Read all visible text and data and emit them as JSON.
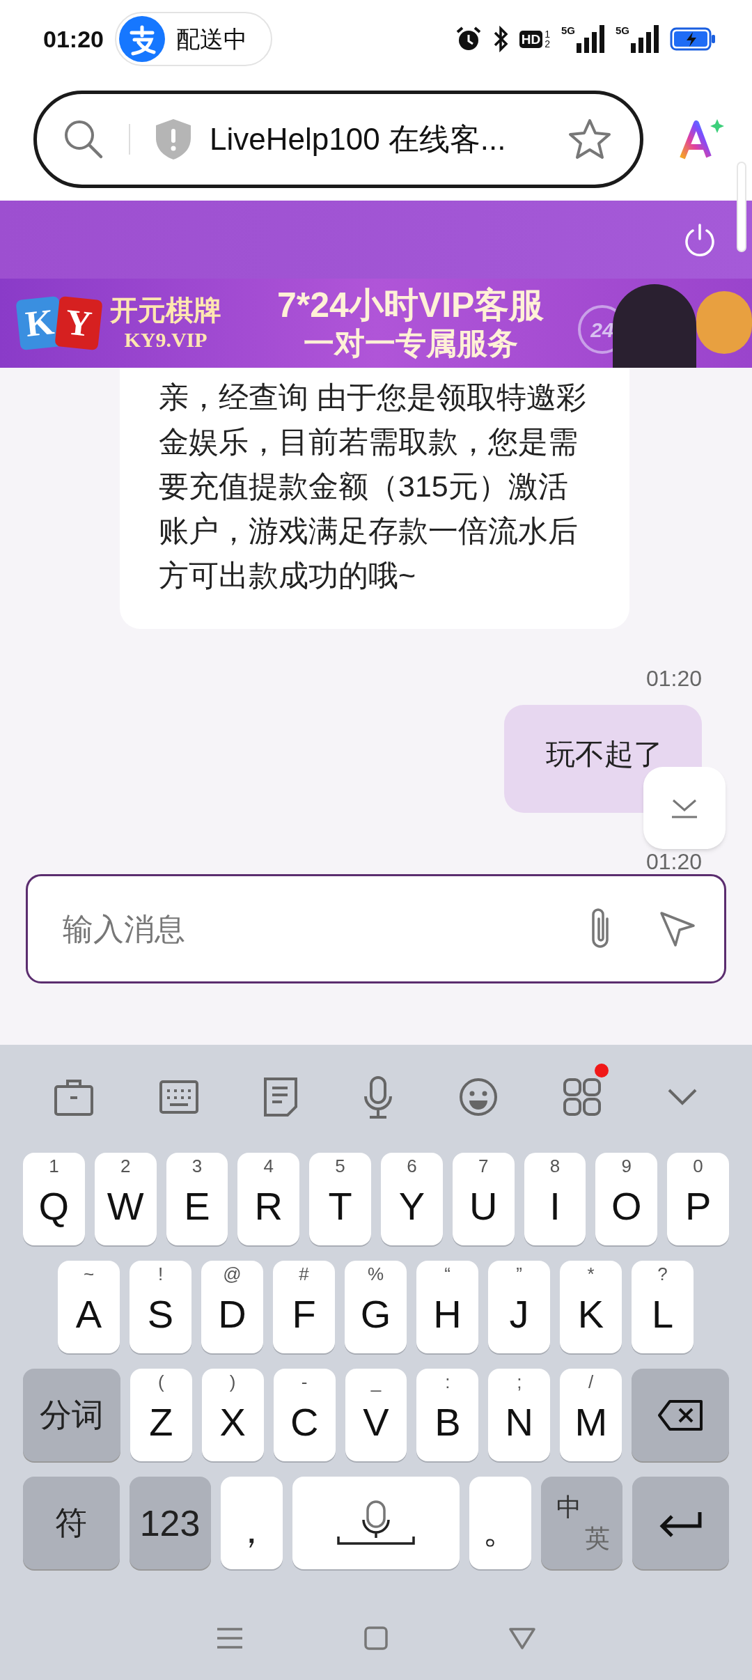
{
  "status_bar": {
    "time": "01:20",
    "chip": "配送中",
    "hd": "HD",
    "sim_slots": [
      "1",
      "2"
    ],
    "networks": [
      "5G",
      "5G"
    ]
  },
  "address_bar": {
    "title": "LiveHelp100 在线客..."
  },
  "banner": {
    "brand": "开元棋牌",
    "domain": "KY9.VIP",
    "logo_letters": [
      "K",
      "Y"
    ],
    "headline": "7*24小时VIP客服",
    "subline": "一对一专属服务",
    "badge": "24"
  },
  "messages": [
    {
      "kind": "agent",
      "text": "亲，经查询 由于您是领取特邀彩金娱乐，目前若需取款，您是需要充值提款金额（315元）激活账户，游戏满足存款一倍流水后方可出款成功的哦~"
    },
    {
      "kind": "time",
      "text": "01:20"
    },
    {
      "kind": "user",
      "text": "玩不起了"
    },
    {
      "kind": "time",
      "text": "01:20"
    }
  ],
  "input": {
    "placeholder": "输入消息"
  },
  "keyboard": {
    "toolbar_badge": true,
    "rows": [
      {
        "keys": [
          {
            "kind": "letter",
            "label": "Q",
            "hint": "1"
          },
          {
            "kind": "letter",
            "label": "W",
            "hint": "2"
          },
          {
            "kind": "letter",
            "label": "E",
            "hint": "3"
          },
          {
            "kind": "letter",
            "label": "R",
            "hint": "4"
          },
          {
            "kind": "letter",
            "label": "T",
            "hint": "5"
          },
          {
            "kind": "letter",
            "label": "Y",
            "hint": "6"
          },
          {
            "kind": "letter",
            "label": "U",
            "hint": "7"
          },
          {
            "kind": "letter",
            "label": "I",
            "hint": "8"
          },
          {
            "kind": "letter",
            "label": "O",
            "hint": "9"
          },
          {
            "kind": "letter",
            "label": "P",
            "hint": "0"
          }
        ]
      },
      {
        "keys": [
          {
            "kind": "letter",
            "label": "A",
            "hint": "~"
          },
          {
            "kind": "letter",
            "label": "S",
            "hint": "!"
          },
          {
            "kind": "letter",
            "label": "D",
            "hint": "@"
          },
          {
            "kind": "letter",
            "label": "F",
            "hint": "#"
          },
          {
            "kind": "letter",
            "label": "G",
            "hint": "%"
          },
          {
            "kind": "letter",
            "label": "H",
            "hint": "“"
          },
          {
            "kind": "letter",
            "label": "J",
            "hint": "”"
          },
          {
            "kind": "letter",
            "label": "K",
            "hint": "*"
          },
          {
            "kind": "letter",
            "label": "L",
            "hint": "?"
          }
        ]
      },
      {
        "keys": [
          {
            "kind": "func",
            "label": "分词"
          },
          {
            "kind": "letter",
            "label": "Z",
            "hint": "("
          },
          {
            "kind": "letter",
            "label": "X",
            "hint": ")"
          },
          {
            "kind": "letter",
            "label": "C",
            "hint": "-"
          },
          {
            "kind": "letter",
            "label": "V",
            "hint": "_"
          },
          {
            "kind": "letter",
            "label": "B",
            "hint": ":"
          },
          {
            "kind": "letter",
            "label": "N",
            "hint": ";"
          },
          {
            "kind": "letter",
            "label": "M",
            "hint": "/"
          },
          {
            "kind": "backspace"
          }
        ]
      },
      {
        "keys": [
          {
            "kind": "func",
            "label": "符"
          },
          {
            "kind": "num",
            "label": "123"
          },
          {
            "kind": "punct",
            "label": "，"
          },
          {
            "kind": "space"
          },
          {
            "kind": "punct",
            "label": "。"
          },
          {
            "kind": "lang",
            "label": "中",
            "hint": "英"
          },
          {
            "kind": "enter"
          }
        ]
      }
    ]
  }
}
